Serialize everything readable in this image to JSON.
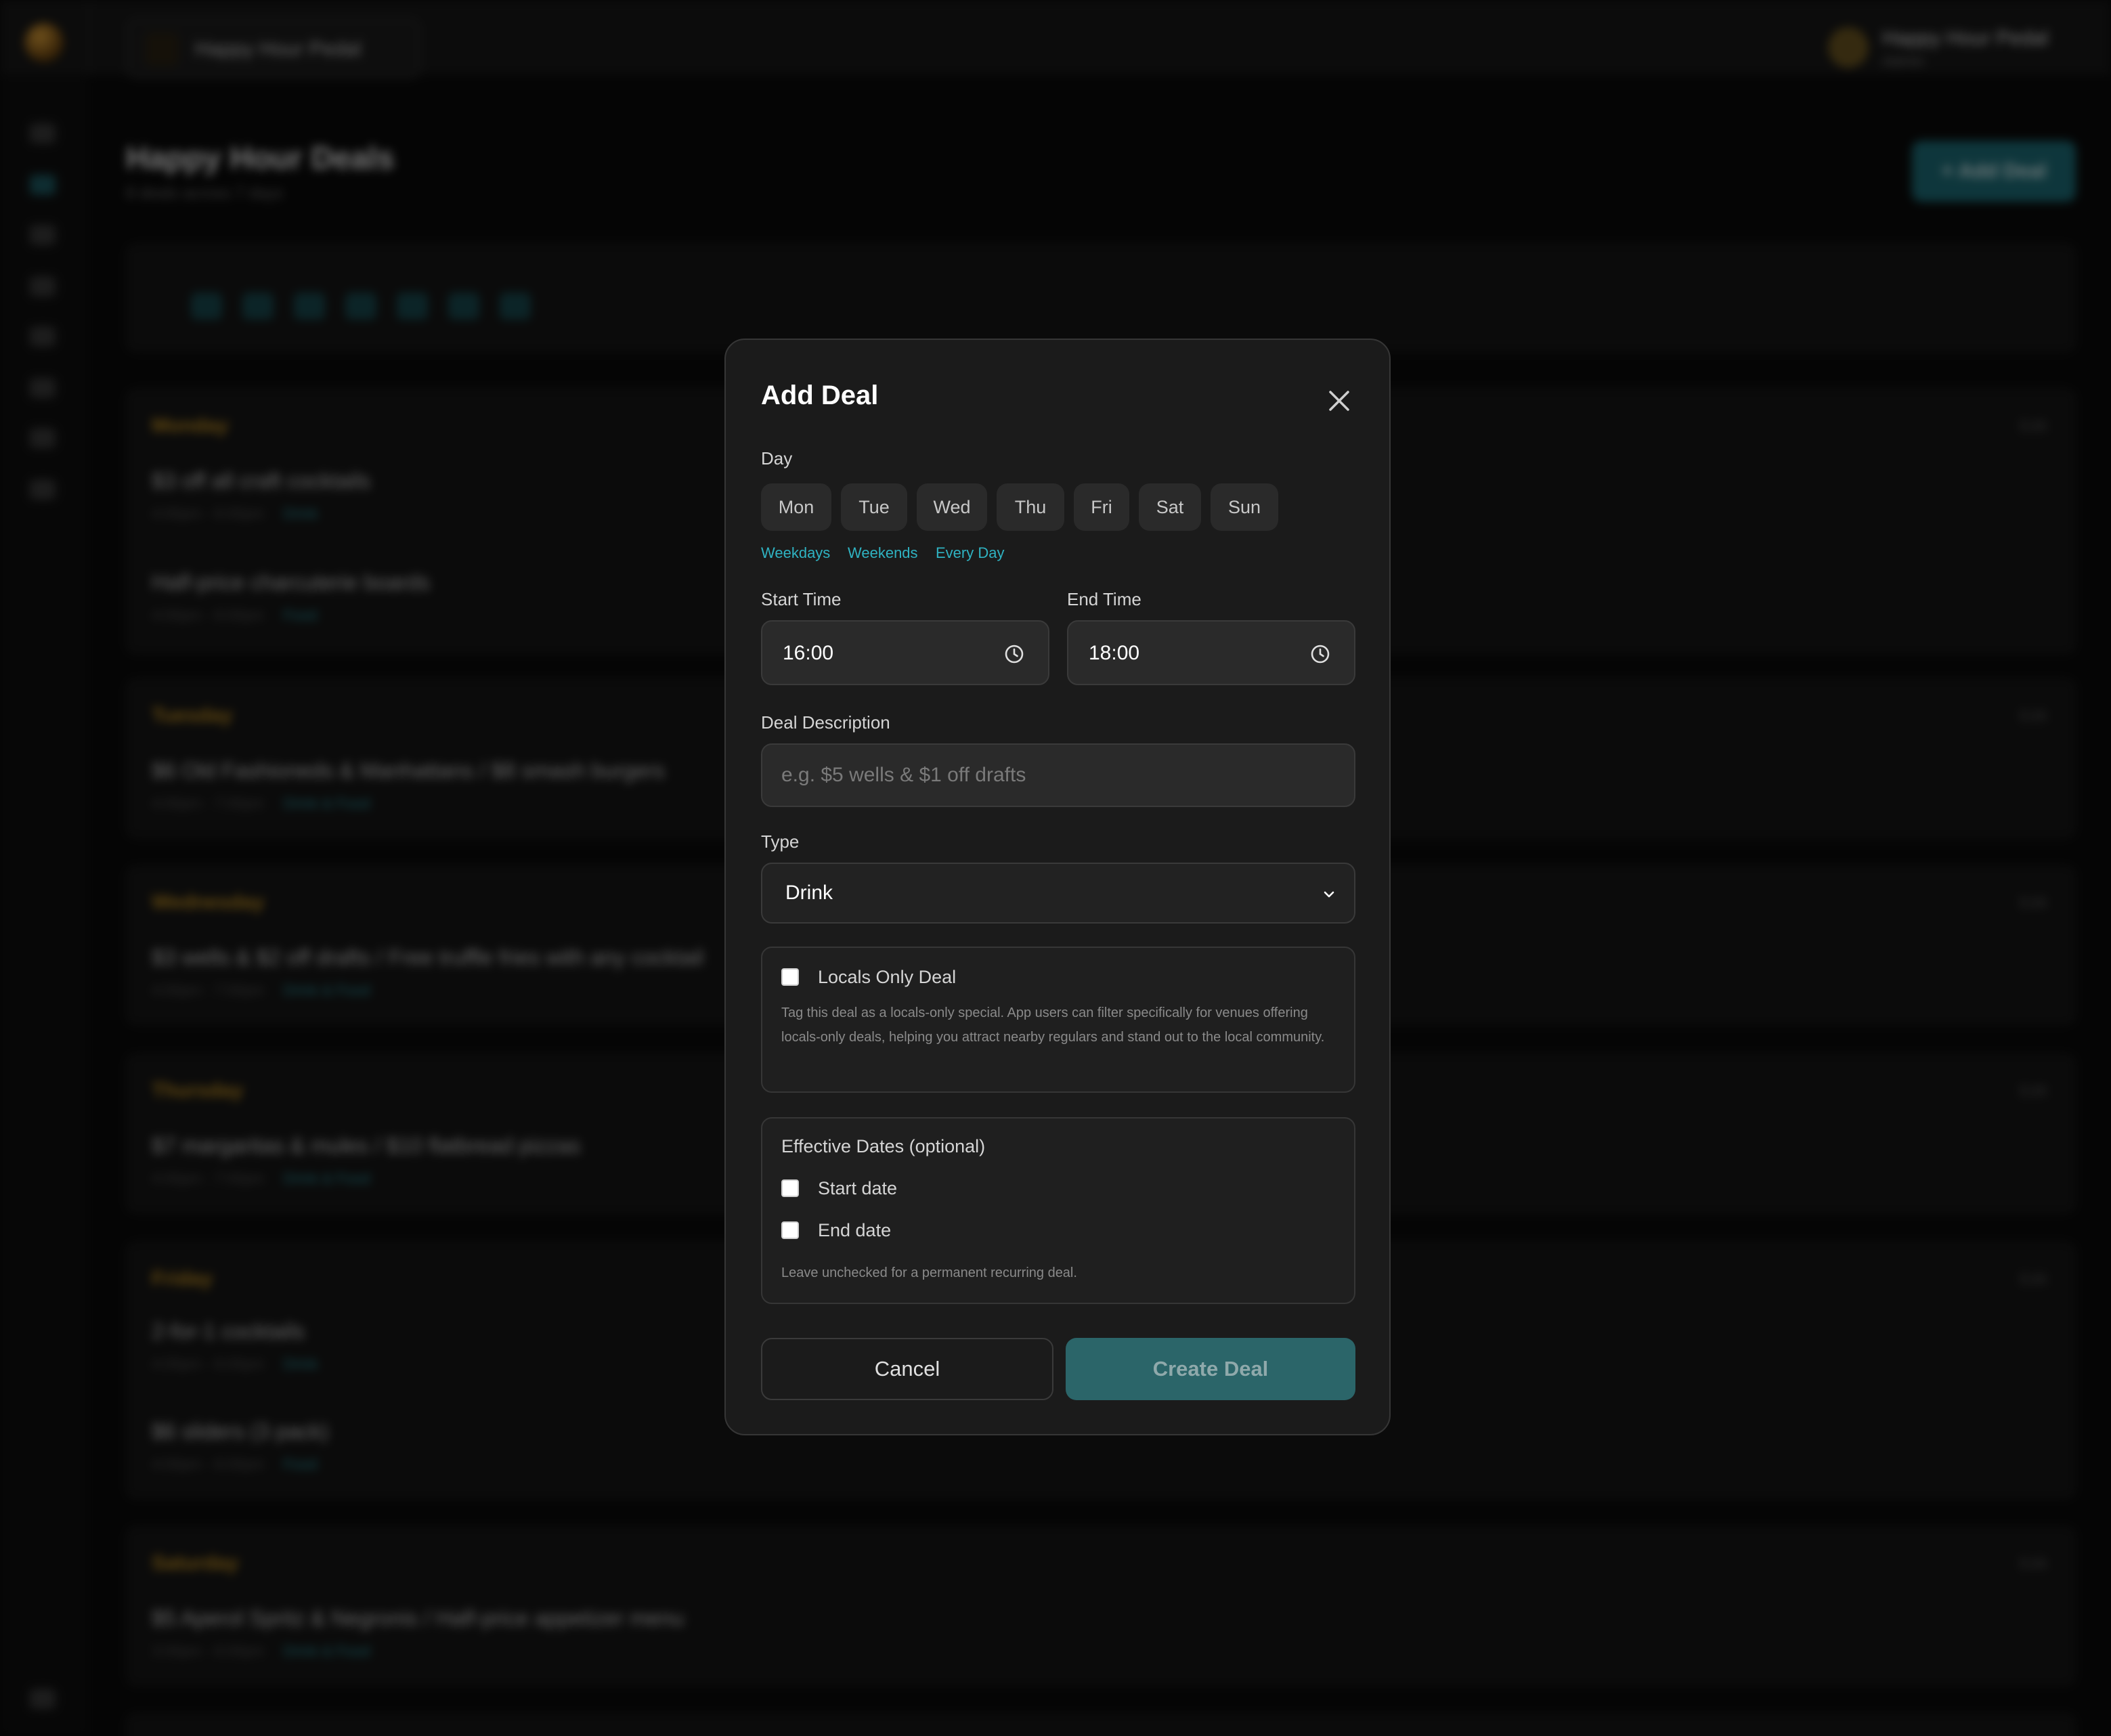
{
  "app": {
    "venue_name": "Happy Hour Pedal",
    "user_name": "Happy Hour Pedal",
    "user_role": "Admin"
  },
  "background": {
    "page_title": "Happy Hour Deals",
    "page_subtitle": "8 deals across 7 days",
    "add_button": "+ Add Deal",
    "day_abbrevs": [
      "Mon",
      "Tue",
      "Wed",
      "Thu",
      "Fri",
      "Sat",
      "Sun"
    ],
    "sections": [
      {
        "day": "Monday",
        "deals": [
          {
            "text": "$3 off all craft cocktails",
            "time": "4:00pm - 6:00pm",
            "type": "Drink"
          },
          {
            "text": "Half-price charcuterie boards",
            "time": "4:00pm - 6:00pm",
            "type": "Food"
          }
        ]
      },
      {
        "day": "Tuesday",
        "deals": [
          {
            "text": "$6 Old Fashioneds & Manhattans / $8 smash burgers",
            "time": "4:00pm - 7:00pm",
            "type": "Drink & Food"
          }
        ]
      },
      {
        "day": "Wednesday",
        "deals": [
          {
            "text": "$3 wells & $2 off drafts / Free truffle fries with any cocktail",
            "time": "4:00pm - 7:00pm",
            "type": "Drink & Food"
          }
        ]
      },
      {
        "day": "Thursday",
        "deals": [
          {
            "text": "$7 margaritas & mules / $10 flatbread pizzas",
            "time": "4:00pm - 7:00pm",
            "type": "Drink & Food"
          }
        ]
      },
      {
        "day": "Friday",
        "deals": [
          {
            "text": "2-for-1 cocktails",
            "time": "4:00pm - 6:00pm",
            "type": "Drink"
          },
          {
            "text": "$6 sliders (3 pack)",
            "time": "4:00pm - 6:00pm",
            "type": "Food"
          }
        ]
      },
      {
        "day": "Saturday",
        "deals": [
          {
            "text": "$5 Aperol Spritz & Negronis / Half-price appetizer menu",
            "time": "3:00pm - 6:00pm",
            "type": "Drink & Food"
          }
        ]
      }
    ],
    "edit_label": "Edit"
  },
  "modal": {
    "title": "Add Deal",
    "day_label": "Day",
    "days": [
      "Mon",
      "Tue",
      "Wed",
      "Thu",
      "Fri",
      "Sat",
      "Sun"
    ],
    "quick_links": [
      "Weekdays",
      "Weekends",
      "Every Day"
    ],
    "start_time_label": "Start Time",
    "start_time_value": "16:00",
    "end_time_label": "End Time",
    "end_time_value": "18:00",
    "description_label": "Deal Description",
    "description_placeholder": "e.g. $5 wells & $1 off drafts",
    "type_label": "Type",
    "type_value": "Drink",
    "locals_label": "Locals Only Deal",
    "locals_help": "Tag this deal as a locals-only special. App users can filter specifically for venues offering locals-only deals, helping you attract nearby regulars and stand out to the local community.",
    "effective_title": "Effective Dates (optional)",
    "start_date_label": "Start date",
    "end_date_label": "End date",
    "effective_help": "Leave unchecked for a permanent recurring deal.",
    "cancel_label": "Cancel",
    "create_label": "Create Deal"
  },
  "colors": {
    "accent_teal": "#2fb3c2",
    "create_button": "#2b6569",
    "day_heading_gold": "#c89321"
  }
}
